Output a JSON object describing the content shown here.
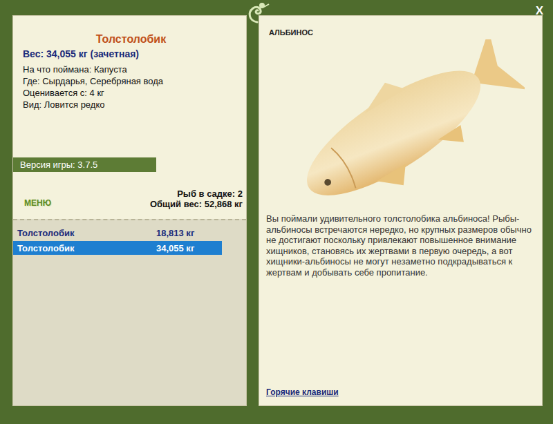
{
  "window": {
    "close": "X"
  },
  "fish": {
    "name": "Толстолобик",
    "weight": "Вес: 34,055 кг (зачетная)",
    "details": [
      "На что поймана: Капуста",
      "Где: Сырдарья, Серебряная вода",
      "Оценивается с: 4 кг",
      "Вид: Ловится редко"
    ]
  },
  "version": "Версия игры: 3.7.5",
  "menu": "МЕНЮ",
  "keepnet": {
    "count": "Рыб в садке: 2",
    "total": "Общий вес: 52,868 кг"
  },
  "catches": [
    {
      "name": "Толстолобик",
      "weight": "18,813 кг",
      "selected": false
    },
    {
      "name": "Толстолобик",
      "weight": "34,055 кг",
      "selected": true
    }
  ],
  "preview": {
    "tag": "АЛЬБИНОС",
    "description": "Вы поймали удивительного толстолобика альбиноса! Рыбы-альбиносы встречаются нередко, но крупных размеров обычно не достигают поскольку привлекают повышенное внимание хищников, становясь их жертвами в первую очередь, а вот хищники-альбиносы не могут незаметно подкрадываться к жертвам и добывать себе пропитание.",
    "link": "Горячие клавиши"
  }
}
